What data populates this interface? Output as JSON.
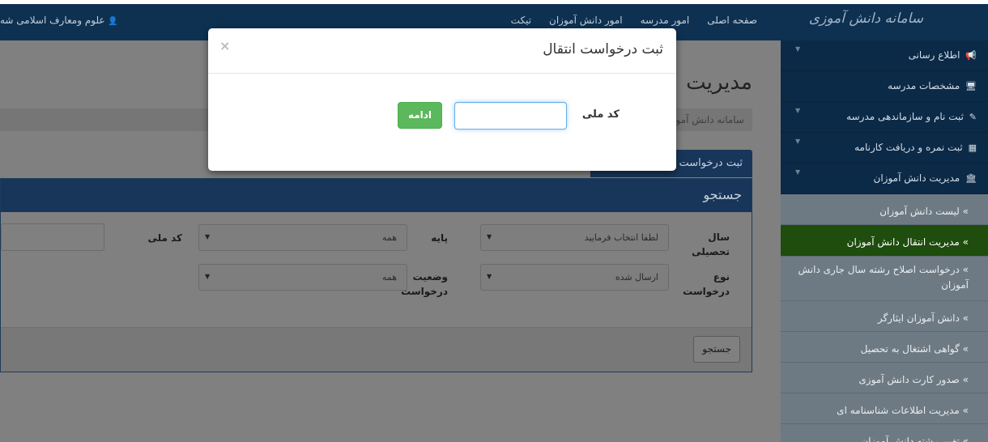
{
  "topbar": {
    "brand": "سامانه دانش آموزی",
    "nav": [
      "صفحه اصلی",
      "امور مدرسه",
      "امور دانش آموزان",
      "تیکت"
    ],
    "user": "علوم ومعارف اسلامی شه",
    "user_icon": "user-icon"
  },
  "sidebar": {
    "items": [
      {
        "label": "اطلاع رسانی",
        "icon": "bullhorn-icon",
        "glyph": "📢"
      },
      {
        "label": "مشخصات مدرسه",
        "icon": "monitor-icon",
        "glyph": "🖥"
      },
      {
        "label": "ثبت نام و سازماندهی مدرسه",
        "icon": "edit-icon",
        "glyph": "✎"
      },
      {
        "label": "ثبت نمره و دریافت کارنامه",
        "icon": "grid-icon",
        "glyph": "▦"
      },
      {
        "label": "مدیریت دانش آموزان",
        "icon": "bank-icon",
        "glyph": "🏛"
      }
    ],
    "subitems": [
      "» لیست دانش آموزان",
      "» مدیریت انتقال دانش آموزان",
      "» درخواست اصلاح رشته سال جاری دانش آموزان",
      "» دانش آموزان ایثارگر",
      "» گواهی اشتغال به تحصیل",
      "» صدور کارت دانش آموزی",
      "» مدیریت اطلاعات شناسنامه ای",
      "» تغییر رشته دانش آموزان"
    ]
  },
  "main": {
    "page_title": "مدیریت",
    "breadcrumb": "سامانه دانش آموز",
    "tab_label": "ثبت درخواست",
    "panel_title": "جستجو",
    "fields": {
      "year_label": "سال تحصیلی",
      "year_value": "لطفا انتخاب فرمایید",
      "grade_label": "پایه",
      "grade_value": "همه",
      "national_code_label": "کد ملی",
      "type_label": "نوع درخواست",
      "type_value": "ارسال شده",
      "status_label": "وضعیت درخواست",
      "status_value": "همه"
    },
    "search_button": "جستجو"
  },
  "modal": {
    "title": "ثبت درخواست انتقال",
    "close": "×",
    "field_label": "کد ملی",
    "field_value": "",
    "submit": "ادامه"
  },
  "colors": {
    "topbar": "#0e3152",
    "sidebar": "#0b2a47",
    "active_item": "#1e4d0e",
    "success": "#5cb85c",
    "focus": "#66afe9"
  }
}
